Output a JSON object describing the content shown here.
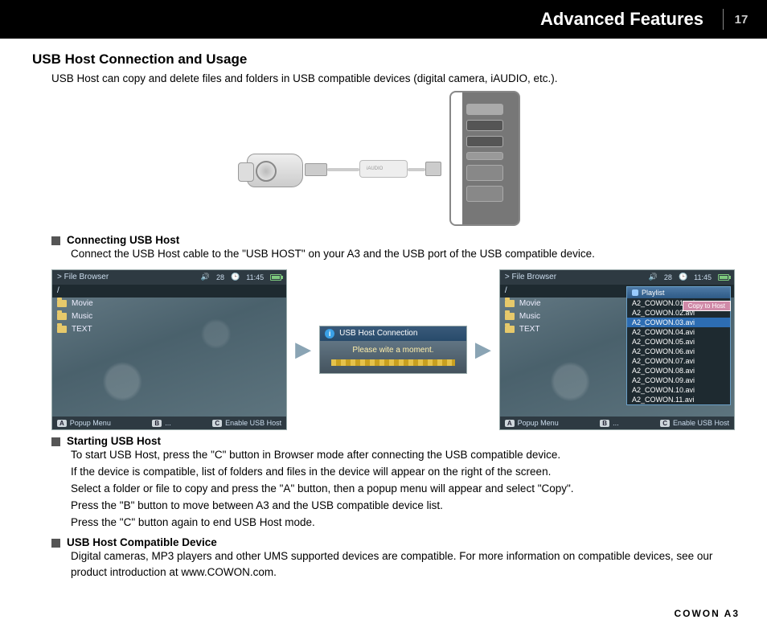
{
  "header": {
    "title": "Advanced Features",
    "page": "17"
  },
  "section": {
    "title": "USB Host Connection and Usage",
    "intro": "USB Host can copy and delete files and folders in USB compatible devices (digital camera, iAUDIO, etc.)."
  },
  "connecting": {
    "heading": "Connecting USB Host",
    "body": "Connect the USB Host cable to the \"USB HOST\" on your A3 and the USB port of the USB compatible device."
  },
  "browser": {
    "breadcrumb": "> File Browser",
    "vol": "28",
    "time": "11:45",
    "path": "/",
    "items": [
      "Movie",
      "Music",
      "TEXT"
    ],
    "bottom": {
      "a": "Popup Menu",
      "b": "...",
      "c": "Enable USB Host"
    }
  },
  "popup": {
    "title": "USB Host Connection",
    "body": "Please wite a moment."
  },
  "playlist": {
    "title": "Playlist",
    "copy_label": "Copy to Host",
    "items": [
      "A2_COWON.01.avi",
      "A2_COWON.02.avi",
      "A2_COWON.03.avi",
      "A2_COWON.04.avi",
      "A2_COWON.05.avi",
      "A2_COWON.06.avi",
      "A2_COWON.07.avi",
      "A2_COWON.08.avi",
      "A2_COWON.09.avi",
      "A2_COWON.10.avi",
      "A2_COWON.11.avi"
    ]
  },
  "starting": {
    "heading": "Starting USB Host",
    "lines": [
      "To start USB Host, press the \"C\" button in Browser mode after connecting the USB compatible device.",
      "If the device is compatible, list of folders and files in the device will appear on the right of the screen.",
      "Select a folder or file to copy and press the \"A\" button, then a popup menu will appear and select \"Copy\".",
      "Press the \"B\" button to move between A3 and the USB compatible device list.",
      "Press the \"C\" button again to end USB Host mode."
    ]
  },
  "compatible": {
    "heading": "USB Host Compatible Device",
    "body": "Digital cameras, MP3 players and other UMS supported devices are compatible. For more information on compatible devices, see our product introduction at www.COWON.com."
  },
  "footer": "COWON A3"
}
